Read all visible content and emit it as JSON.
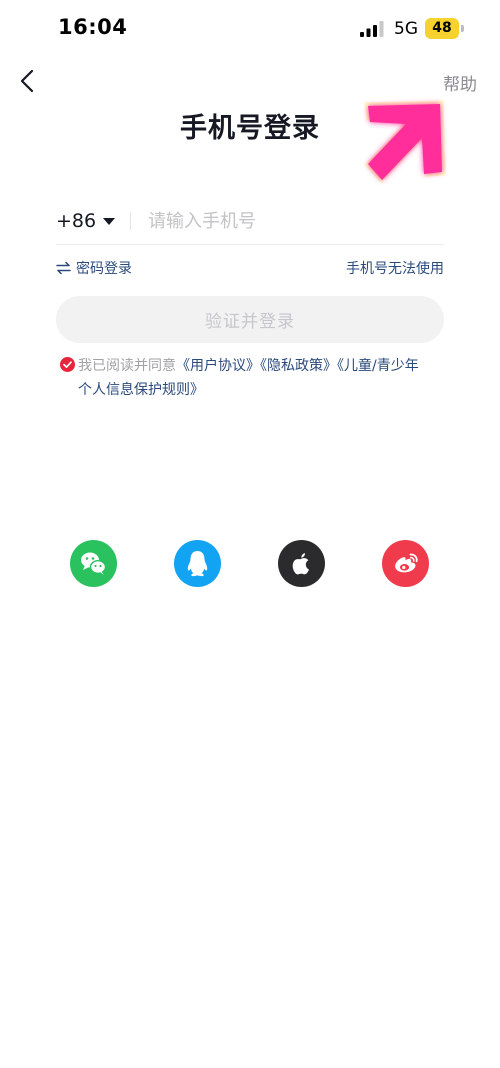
{
  "status_bar": {
    "time": "16:04",
    "network": "5G",
    "battery_level": "48",
    "battery_color": "#f6d22f"
  },
  "nav": {
    "back_icon": "chevron-left-icon",
    "help_label": "帮助"
  },
  "title": "手机号登录",
  "phone": {
    "country_code": "+86",
    "placeholder": "请输入手机号",
    "value": ""
  },
  "links": {
    "password_login": "密码登录",
    "phone_unusable": "手机号无法使用"
  },
  "login_button": {
    "label": "验证并登录"
  },
  "agreement": {
    "checked": true,
    "prefix": "我已阅读并同意",
    "user_agreement": "《用户协议》",
    "privacy_policy": "《隐私政策》",
    "children_rules_line1": "《儿童/青少年",
    "children_rules_line2": "个人信息保护规则》"
  },
  "social_logins": [
    {
      "name": "wechat",
      "icon": "wechat-icon",
      "color": "#2ac15f"
    },
    {
      "name": "qq",
      "icon": "qq-icon",
      "color": "#12a3f3"
    },
    {
      "name": "apple",
      "icon": "apple-icon",
      "color": "#2b2b2d"
    },
    {
      "name": "weibo",
      "icon": "weibo-icon",
      "color": "#f03b4d"
    }
  ],
  "colors": {
    "link": "#2b4a7c",
    "accent_red": "#e8243d",
    "annotation_arrow": "#ff2d9b"
  }
}
